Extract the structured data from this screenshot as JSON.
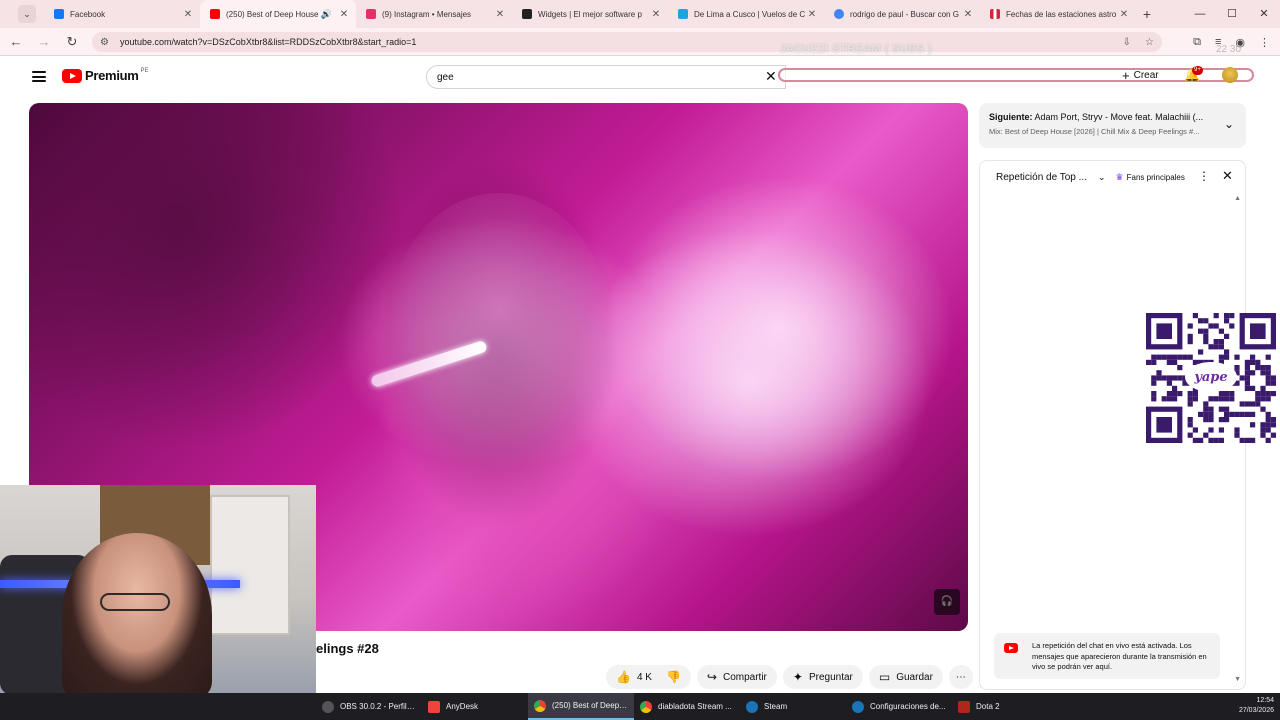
{
  "browser": {
    "tabs": [
      {
        "label": "Facebook",
        "color": "#1877f2",
        "active": false
      },
      {
        "label": "(250) Best of Deep House",
        "color": "#ff0000",
        "active": true
      },
      {
        "label": "(9) Instagram • Mensajes",
        "color": "#e1306c",
        "active": false
      },
      {
        "label": "Widgets | El mejor software p",
        "color": "#222222",
        "active": false
      },
      {
        "label": "De Lima a Cusco | Vuelos de C",
        "color": "#1fa3e0",
        "active": false
      },
      {
        "label": "rodrigo de paul - Buscar con G",
        "color": "#4285f4",
        "active": false
      },
      {
        "label": "Fechas de las estaciones astro",
        "color": "#d4273c",
        "active": false
      }
    ],
    "url": "youtube.com/watch?v=DSzCobXtbr8&list=RDDSzCobXtbr8&start_radio=1",
    "overlay_text": "JACUZZI STREAM ( SUBS )",
    "overlay_clock": "22 30"
  },
  "youtube": {
    "brand": "Premium",
    "country": "PE",
    "search_value": "gee",
    "create_label": "Crear",
    "notif_badge": "9+",
    "video_title": "elings #28",
    "actions": {
      "likes": "4 K",
      "share": "Compartir",
      "ask": "Preguntar",
      "save": "Guardar"
    },
    "up_next": {
      "label": "Siguiente:",
      "title": "Adam Port, Stryv - Move feat. Malachiii (...",
      "subtitle": "Mix: Best of Deep House [2026] | Chill Mix & Deep Feelings #..."
    },
    "chat": {
      "title": "Repetición de Top ...",
      "fans": "Fans principales",
      "notice": "La repetición del chat en vivo está activada. Los mensajes que aparecieron durante la transmisión en vivo se podrán ver aquí."
    }
  },
  "qr": {
    "label": "yape"
  },
  "taskbar": {
    "items": [
      {
        "label": "OBS 30.0.2 - Perfil: ...",
        "color": "#555555"
      },
      {
        "label": "AnyDesk",
        "color": "#ef443b"
      },
      {
        "label": "(250) Best of Deep ...",
        "color": "#e9b23a"
      },
      {
        "label": "diabladota Stream ...",
        "color": "#e9b23a"
      },
      {
        "label": "Steam",
        "color": "#1b73b8"
      },
      {
        "label": "Configuraciones de...",
        "color": "#1b73b8"
      },
      {
        "label": "Dota 2",
        "color": "#b1261c"
      }
    ],
    "time": "12:54",
    "date": "27/03/2026"
  }
}
